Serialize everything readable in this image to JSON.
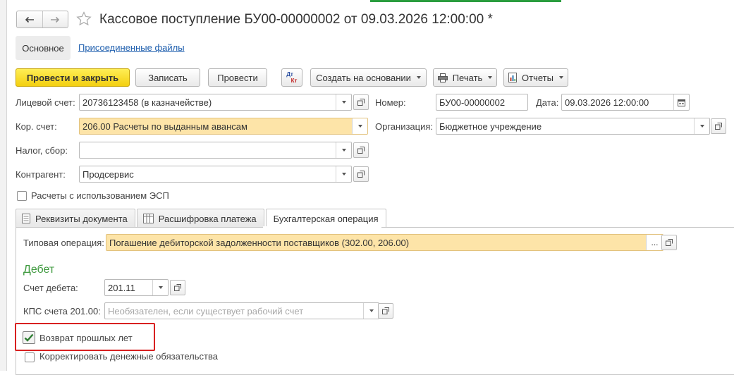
{
  "window": {
    "title": "Кассовое поступление БУ00-00000002 от 09.03.2026 12:00:00 *"
  },
  "icons": {
    "back": "arrow-left-icon",
    "forward": "arrow-right-icon",
    "favorite": "star-icon",
    "dtkt": "debit-credit-icon",
    "print": "printer-icon",
    "reports": "report-icon",
    "open": "open-form-icon",
    "calendar": "calendar-icon",
    "tab_doc": "document-icon",
    "tab_table": "table-icon"
  },
  "colors": {
    "primary_button": "#f3cf10",
    "field_highlight": "#fde4a8",
    "link": "#1f5fae",
    "section_title": "#3f9a3f",
    "highlight_frame": "#d82020"
  },
  "nav_tabs": {
    "main": "Основное",
    "files": "Присоединенные файлы"
  },
  "toolbar": {
    "post_close": "Провести и закрыть",
    "save": "Записать",
    "post": "Провести",
    "dtkt_top": "Дт",
    "dtkt_bottom": "Кт",
    "create_based": "Создать на основании",
    "print": "Печать",
    "reports": "Отчеты"
  },
  "form": {
    "account": {
      "label": "Лицевой счет:",
      "value": "20736123458 (в казначействе)"
    },
    "number": {
      "label": "Номер:",
      "value": "БУ00-00000002"
    },
    "date": {
      "label": "Дата:",
      "value": "09.03.2026 12:00:00"
    },
    "corr_account": {
      "label": "Кор. счет:",
      "value": "206.00 Расчеты по выданным авансам"
    },
    "organization": {
      "label": "Организация:",
      "value": "Бюджетное учреждение"
    },
    "tax": {
      "label": "Налог, сбор:",
      "value": ""
    },
    "counterparty": {
      "label": "Контрагент:",
      "value": "Продсервис"
    },
    "esp": {
      "label": "Расчеты с использованием ЭСП",
      "checked": false
    }
  },
  "tabs": [
    {
      "label": "Реквизиты документа",
      "active": false
    },
    {
      "label": "Расшифровка платежа",
      "active": false
    },
    {
      "label": "Бухгалтерская операция",
      "active": true
    }
  ],
  "operation": {
    "typical": {
      "label": "Типовая операция:",
      "value": "Погашение дебиторской задолженности поставщиков (302.00, 206.00)",
      "dots": "..."
    },
    "debit_title": "Дебет",
    "debit_account": {
      "label": "Счет дебета:",
      "value": "201.11"
    },
    "kps": {
      "label": "КПС счета 201.00:",
      "placeholder": "Необязателен, если существует рабочий счет"
    },
    "prior_year_return": {
      "label": "Возврат прошлых лет",
      "checked": true
    },
    "adjust_obligations": {
      "label": "Корректировать денежные обязательства",
      "checked": false
    }
  }
}
